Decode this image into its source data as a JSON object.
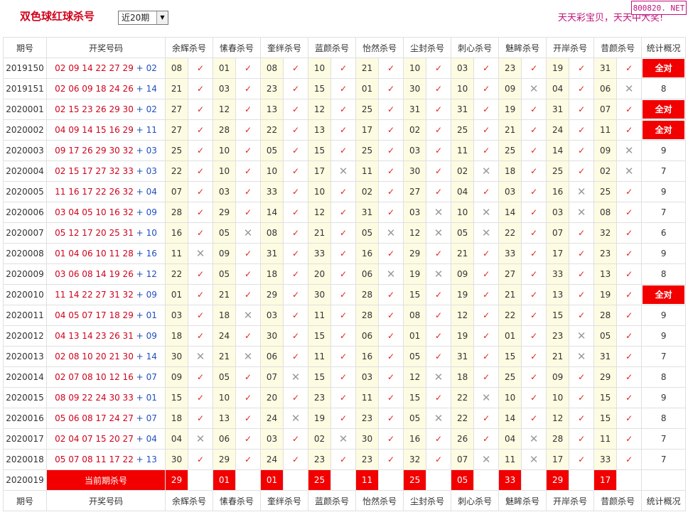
{
  "header": {
    "title": "双色球红球杀号",
    "select_value": "近20期",
    "slogan": "天天彩宝贝，天天中大奖!",
    "watermark": "800820. NET"
  },
  "columns": {
    "issue": "期号",
    "draw": "开奖号码",
    "experts": [
      "余辉杀号",
      "愫春杀号",
      "奎绊杀号",
      "蓝颜杀号",
      "怡然杀号",
      "尘封杀号",
      "刺心杀号",
      "魅眸杀号",
      "开岸杀号",
      "昔颜杀号"
    ],
    "stats": "统计概况"
  },
  "rows": [
    {
      "issue": "2019150",
      "red": "02 09 14 22 27 29",
      "plus": "+",
      "blue": "02",
      "kills": [
        "08",
        "01",
        "08",
        "10",
        "21",
        "10",
        "03",
        "23",
        "19",
        "31"
      ],
      "ok": [
        1,
        1,
        1,
        1,
        1,
        1,
        1,
        1,
        1,
        1
      ],
      "stat": "全对"
    },
    {
      "issue": "2019151",
      "red": "02 06 09 18 24 26",
      "plus": "+",
      "blue": "14",
      "kills": [
        "21",
        "03",
        "23",
        "15",
        "01",
        "30",
        "10",
        "09",
        "04",
        "06"
      ],
      "ok": [
        1,
        1,
        1,
        1,
        1,
        1,
        1,
        0,
        1,
        0
      ],
      "stat": "8"
    },
    {
      "issue": "2020001",
      "red": "02 15 23 26 29 30",
      "plus": "+",
      "blue": "02",
      "kills": [
        "27",
        "12",
        "13",
        "12",
        "25",
        "31",
        "31",
        "19",
        "31",
        "07"
      ],
      "ok": [
        1,
        1,
        1,
        1,
        1,
        1,
        1,
        1,
        1,
        1
      ],
      "stat": "全对"
    },
    {
      "issue": "2020002",
      "red": "04 09 14 15 16 29",
      "plus": "+",
      "blue": "11",
      "kills": [
        "27",
        "28",
        "22",
        "13",
        "17",
        "02",
        "25",
        "21",
        "24",
        "11"
      ],
      "ok": [
        1,
        1,
        1,
        1,
        1,
        1,
        1,
        1,
        1,
        1
      ],
      "stat": "全对"
    },
    {
      "issue": "2020003",
      "red": "09 17 26 29 30 32",
      "plus": "+",
      "blue": "03",
      "kills": [
        "25",
        "10",
        "05",
        "15",
        "25",
        "03",
        "11",
        "25",
        "14",
        "09"
      ],
      "ok": [
        1,
        1,
        1,
        1,
        1,
        1,
        1,
        1,
        1,
        0
      ],
      "stat": "9"
    },
    {
      "issue": "2020004",
      "red": "02 15 17 27 32 33",
      "plus": "+",
      "blue": "03",
      "kills": [
        "22",
        "10",
        "10",
        "17",
        "11",
        "30",
        "02",
        "18",
        "25",
        "02"
      ],
      "ok": [
        1,
        1,
        1,
        0,
        1,
        1,
        0,
        1,
        1,
        0
      ],
      "stat": "7"
    },
    {
      "issue": "2020005",
      "red": "11 16 17 22 26 32",
      "plus": "+",
      "blue": "04",
      "kills": [
        "07",
        "03",
        "33",
        "10",
        "02",
        "27",
        "04",
        "03",
        "16",
        "25"
      ],
      "ok": [
        1,
        1,
        1,
        1,
        1,
        1,
        1,
        1,
        0,
        1
      ],
      "stat": "9"
    },
    {
      "issue": "2020006",
      "red": "03 04 05 10 16 32",
      "plus": "+",
      "blue": "09",
      "kills": [
        "28",
        "29",
        "14",
        "12",
        "31",
        "03",
        "10",
        "14",
        "03",
        "08"
      ],
      "ok": [
        1,
        1,
        1,
        1,
        1,
        0,
        0,
        1,
        0,
        1
      ],
      "stat": "7"
    },
    {
      "issue": "2020007",
      "red": "05 12 17 20 25 31",
      "plus": "+",
      "blue": "10",
      "kills": [
        "16",
        "05",
        "08",
        "21",
        "05",
        "12",
        "05",
        "22",
        "07",
        "32"
      ],
      "ok": [
        1,
        0,
        1,
        1,
        0,
        0,
        0,
        1,
        1,
        1
      ],
      "stat": "6"
    },
    {
      "issue": "2020008",
      "red": "01 04 06 10 11 28",
      "plus": "+",
      "blue": "16",
      "kills": [
        "11",
        "09",
        "31",
        "33",
        "16",
        "29",
        "21",
        "33",
        "17",
        "23"
      ],
      "ok": [
        0,
        1,
        1,
        1,
        1,
        1,
        1,
        1,
        1,
        1
      ],
      "stat": "9"
    },
    {
      "issue": "2020009",
      "red": "03 06 08 14 19 26",
      "plus": "+",
      "blue": "12",
      "kills": [
        "22",
        "05",
        "18",
        "20",
        "06",
        "19",
        "09",
        "27",
        "33",
        "13"
      ],
      "ok": [
        1,
        1,
        1,
        1,
        0,
        0,
        1,
        1,
        1,
        1
      ],
      "stat": "8"
    },
    {
      "issue": "2020010",
      "red": "11 14 22 27 31 32",
      "plus": "+",
      "blue": "09",
      "kills": [
        "01",
        "21",
        "29",
        "30",
        "28",
        "15",
        "19",
        "21",
        "13",
        "19"
      ],
      "ok": [
        1,
        1,
        1,
        1,
        1,
        1,
        1,
        1,
        1,
        1
      ],
      "stat": "全对"
    },
    {
      "issue": "2020011",
      "red": "04 05 07 17 18 29",
      "plus": "+",
      "blue": "01",
      "kills": [
        "03",
        "18",
        "03",
        "11",
        "28",
        "08",
        "12",
        "22",
        "15",
        "28"
      ],
      "ok": [
        1,
        0,
        1,
        1,
        1,
        1,
        1,
        1,
        1,
        1
      ],
      "stat": "9"
    },
    {
      "issue": "2020012",
      "red": "04 13 14 23 26 31",
      "plus": "+",
      "blue": "09",
      "kills": [
        "18",
        "24",
        "30",
        "15",
        "06",
        "01",
        "19",
        "01",
        "23",
        "05"
      ],
      "ok": [
        1,
        1,
        1,
        1,
        1,
        1,
        1,
        1,
        0,
        1
      ],
      "stat": "9"
    },
    {
      "issue": "2020013",
      "red": "02 08 10 20 21 30",
      "plus": "+",
      "blue": "14",
      "kills": [
        "30",
        "21",
        "06",
        "11",
        "16",
        "05",
        "31",
        "15",
        "21",
        "31"
      ],
      "ok": [
        0,
        0,
        1,
        1,
        1,
        1,
        1,
        1,
        0,
        1
      ],
      "stat": "7"
    },
    {
      "issue": "2020014",
      "red": "02 07 08 10 12 16",
      "plus": "+",
      "blue": "07",
      "kills": [
        "09",
        "05",
        "07",
        "15",
        "03",
        "12",
        "18",
        "25",
        "09",
        "29"
      ],
      "ok": [
        1,
        1,
        0,
        1,
        1,
        0,
        1,
        1,
        1,
        1
      ],
      "stat": "8"
    },
    {
      "issue": "2020015",
      "red": "08 09 22 24 30 33",
      "plus": "+",
      "blue": "01",
      "kills": [
        "15",
        "10",
        "20",
        "23",
        "11",
        "15",
        "22",
        "10",
        "10",
        "15"
      ],
      "ok": [
        1,
        1,
        1,
        1,
        1,
        1,
        0,
        1,
        1,
        1
      ],
      "stat": "9"
    },
    {
      "issue": "2020016",
      "red": "05 06 08 17 24 27",
      "plus": "+",
      "blue": "07",
      "kills": [
        "18",
        "13",
        "24",
        "19",
        "23",
        "05",
        "22",
        "14",
        "12",
        "15"
      ],
      "ok": [
        1,
        1,
        0,
        1,
        1,
        0,
        1,
        1,
        1,
        1
      ],
      "stat": "8"
    },
    {
      "issue": "2020017",
      "red": "02 04 07 15 20 27",
      "plus": "+",
      "blue": "04",
      "kills": [
        "04",
        "06",
        "03",
        "02",
        "30",
        "16",
        "26",
        "04",
        "28",
        "11"
      ],
      "ok": [
        0,
        1,
        1,
        0,
        1,
        1,
        1,
        0,
        1,
        1
      ],
      "stat": "7"
    },
    {
      "issue": "2020018",
      "red": "05 07 08 11 17 22",
      "plus": "+",
      "blue": "13",
      "kills": [
        "30",
        "29",
        "24",
        "23",
        "23",
        "32",
        "07",
        "11",
        "17",
        "33"
      ],
      "ok": [
        1,
        1,
        1,
        1,
        1,
        1,
        0,
        0,
        1,
        1
      ],
      "stat": "7"
    }
  ],
  "current": {
    "issue": "2020019",
    "label": "当前期杀号",
    "kills": [
      "29",
      "01",
      "01",
      "25",
      "11",
      "25",
      "05",
      "33",
      "29",
      "17"
    ]
  },
  "marks": {
    "ok": "✓",
    "fail": "✕"
  }
}
